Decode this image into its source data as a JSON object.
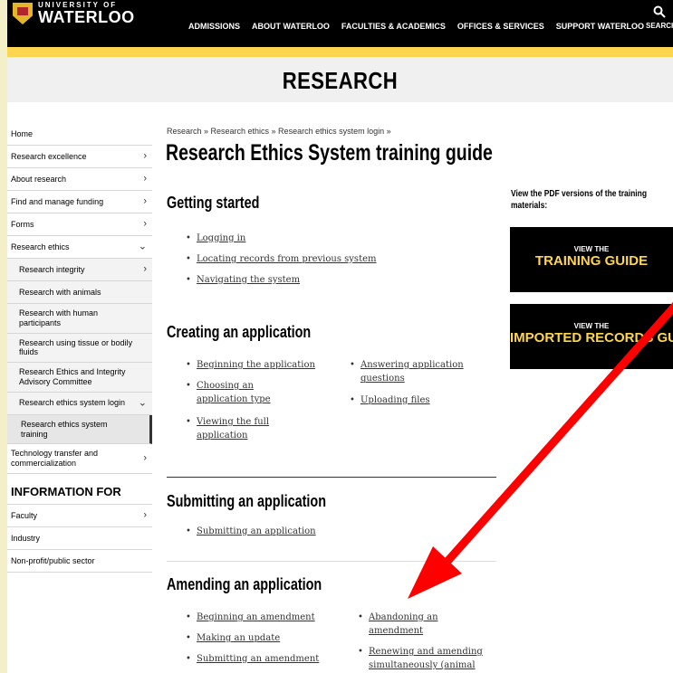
{
  "header": {
    "logo_small": "UNIVERSITY OF",
    "logo_big": "WATERLOO",
    "nav": [
      "ADMISSIONS",
      "ABOUT WATERLOO",
      "FACULTIES & ACADEMICS",
      "OFFICES & SERVICES",
      "SUPPORT WATERLOO"
    ],
    "search_label": "SEARCH"
  },
  "banner": {
    "title": "RESEARCH"
  },
  "sidebar": {
    "items": [
      {
        "label": "Home",
        "chevron": ""
      },
      {
        "label": "Research excellence",
        "chevron": "›"
      },
      {
        "label": "About research",
        "chevron": "›"
      },
      {
        "label": "Find and manage funding",
        "chevron": "›"
      },
      {
        "label": "Forms",
        "chevron": "›"
      },
      {
        "label": "Research ethics",
        "chevron": "⌄"
      },
      {
        "label": "Research integrity",
        "chevron": "›"
      },
      {
        "label": "Research with animals",
        "chevron": ""
      },
      {
        "label": "Research with human participants",
        "chevron": ""
      },
      {
        "label": "Research using tissue or bodily fluids",
        "chevron": ""
      },
      {
        "label": "Research Ethics and Integrity Advisory Committee",
        "chevron": ""
      },
      {
        "label": "Research ethics system login",
        "chevron": "⌄"
      },
      {
        "label": "Research ethics system training",
        "chevron": ""
      },
      {
        "label": "Technology transfer and commercialization",
        "chevron": "›"
      }
    ],
    "info_heading": "INFORMATION FOR",
    "info_items": [
      {
        "label": "Faculty",
        "chevron": "›"
      },
      {
        "label": "Industry",
        "chevron": ""
      },
      {
        "label": "Non-profit/public sector",
        "chevron": ""
      }
    ]
  },
  "main": {
    "breadcrumb": "Research » Research ethics » Research ethics system login »",
    "title": "Research Ethics System training guide",
    "sections": {
      "getting_started": {
        "heading": "Getting started",
        "links": [
          "Logging in",
          "Locating records from previous system",
          "Navigating the system"
        ]
      },
      "creating": {
        "heading": "Creating an application",
        "links": [
          "Beginning the application",
          "Choosing an application type",
          "Viewing the full application",
          "Answering application questions",
          "Uploading files"
        ]
      },
      "submitting": {
        "heading": "Submitting an application",
        "links": [
          "Submitting an application"
        ]
      },
      "amending": {
        "heading": "Amending an application",
        "links": [
          "Beginning an amendment",
          "Making an update",
          "Submitting an amendment",
          "Abandoning an amendment",
          "Renewing and amending simultaneously (animal"
        ]
      }
    }
  },
  "right": {
    "pdf_note": "View the PDF versions of the training materials:",
    "buttons": [
      {
        "small": "VIEW THE",
        "big": "TRAINING GUIDE"
      },
      {
        "small": "VIEW THE",
        "big": "IMPORTED RECORDS GUIDE"
      }
    ]
  },
  "colors": {
    "gold": "#fdd54f",
    "annotation_arrow": "#ff0000"
  }
}
